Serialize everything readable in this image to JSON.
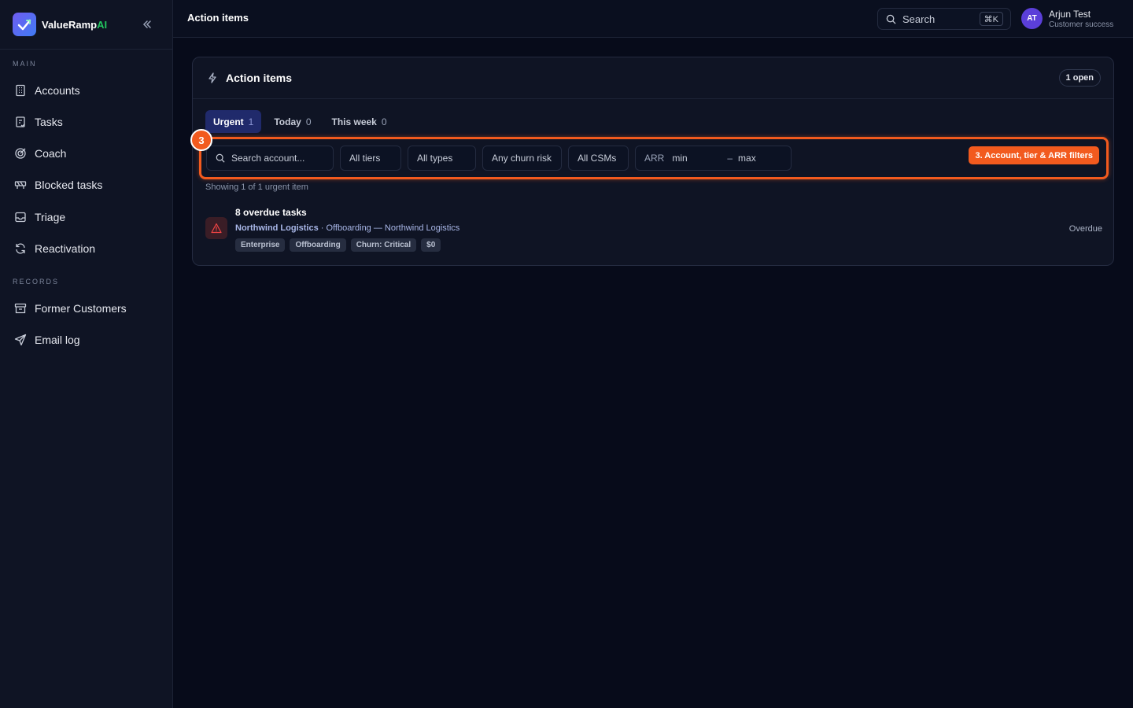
{
  "brand": {
    "name_part1": "ValueRamp",
    "name_part2": "AI"
  },
  "sidebar": {
    "main_label": "MAIN",
    "records_label": "RECORDS",
    "items": [
      {
        "label": "Accounts",
        "icon": "building-icon"
      },
      {
        "label": "Tasks",
        "icon": "clipboard-icon"
      },
      {
        "label": "Coach",
        "icon": "target-icon"
      },
      {
        "label": "Blocked tasks",
        "icon": "barrier-icon"
      },
      {
        "label": "Triage",
        "icon": "inbox-icon"
      },
      {
        "label": "Reactivation",
        "icon": "refresh-icon"
      },
      {
        "label": "Former Customers",
        "icon": "archive-icon"
      },
      {
        "label": "Email log",
        "icon": "send-icon"
      }
    ]
  },
  "header": {
    "title": "Action items",
    "search_label": "Search",
    "search_shortcut": "⌘K",
    "user": {
      "initials": "AT",
      "name": "Arjun Test",
      "role": "Customer success"
    }
  },
  "card": {
    "title": "Action items",
    "open_badge": "1 open",
    "tabs": [
      {
        "label": "Urgent",
        "count": "1",
        "active": true
      },
      {
        "label": "Today",
        "count": "0",
        "active": false
      },
      {
        "label": "This week",
        "count": "0",
        "active": false
      }
    ],
    "filters": {
      "search_placeholder": "Search account...",
      "tiers": "All tiers",
      "types": "All types",
      "churn": "Any churn risk",
      "csms": "All CSMs",
      "arr_label": "ARR",
      "arr_min_placeholder": "min",
      "arr_separator": "–",
      "arr_max_placeholder": "max"
    },
    "tour": {
      "step": "3",
      "hint": "3. Account, tier & ARR filters"
    },
    "showing_text": "Showing 1 of 1 urgent item",
    "items": [
      {
        "title": "8 overdue tasks",
        "account": "Northwind Logistics",
        "detail": "· Offboarding — Northwind Logistics",
        "tags": [
          "Enterprise",
          "Offboarding",
          "Churn: Critical",
          "$0"
        ],
        "status": "Overdue"
      }
    ]
  },
  "colors": {
    "accent": "#f25a1e",
    "active_tab": "#202a6b",
    "brand_green": "#22c55e",
    "danger": "#ef4444"
  }
}
